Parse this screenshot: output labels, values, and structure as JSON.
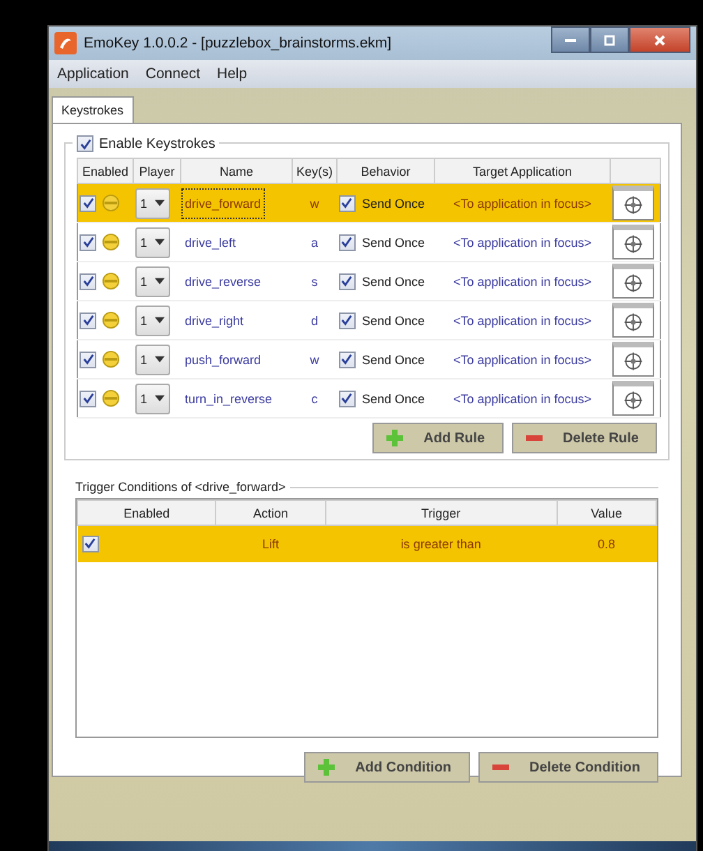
{
  "window": {
    "title": "EmoKey 1.0.0.2 - [puzzlebox_brainstorms.ekm]"
  },
  "menu": [
    "Application",
    "Connect",
    "Help"
  ],
  "tabs": [
    {
      "label": "Keystrokes",
      "selected": true
    }
  ],
  "enable_keystrokes": {
    "label": "Enable Keystrokes",
    "checked": true
  },
  "rules": {
    "columns": [
      "Enabled",
      "Player",
      "Name",
      "Key(s)",
      "Behavior",
      "Target Application"
    ],
    "rows": [
      {
        "enabled": true,
        "player": "1",
        "name": "drive_forward",
        "key": "w",
        "send_once": true,
        "behavior": "Send Once",
        "target": "<To application in focus>",
        "selected": true
      },
      {
        "enabled": true,
        "player": "1",
        "name": "drive_left",
        "key": "a",
        "send_once": true,
        "behavior": "Send Once",
        "target": "<To application in focus>",
        "selected": false
      },
      {
        "enabled": true,
        "player": "1",
        "name": "drive_reverse",
        "key": "s",
        "send_once": true,
        "behavior": "Send Once",
        "target": "<To application in focus>",
        "selected": false
      },
      {
        "enabled": true,
        "player": "1",
        "name": "drive_right",
        "key": "d",
        "send_once": true,
        "behavior": "Send Once",
        "target": "<To application in focus>",
        "selected": false
      },
      {
        "enabled": true,
        "player": "1",
        "name": "push_forward",
        "key": "w",
        "send_once": true,
        "behavior": "Send Once",
        "target": "<To application in focus>",
        "selected": false
      },
      {
        "enabled": true,
        "player": "1",
        "name": "turn_in_reverse",
        "key": "c",
        "send_once": true,
        "behavior": "Send Once",
        "target": "<To application in focus>",
        "selected": false
      }
    ],
    "buttons": [
      {
        "kind": "add",
        "label": "Add Rule"
      },
      {
        "kind": "delete",
        "label": "Delete Rule"
      }
    ]
  },
  "conditions": {
    "title": "Trigger Conditions of <drive_forward>",
    "columns": [
      "Enabled",
      "Action",
      "Trigger",
      "Value"
    ],
    "rows": [
      {
        "enabled": true,
        "action": "Lift",
        "trigger": "is greater than",
        "value": "0.8",
        "selected": true
      }
    ],
    "buttons": [
      {
        "kind": "add",
        "label": "Add Condition"
      },
      {
        "kind": "delete",
        "label": "Delete Condition"
      }
    ]
  }
}
